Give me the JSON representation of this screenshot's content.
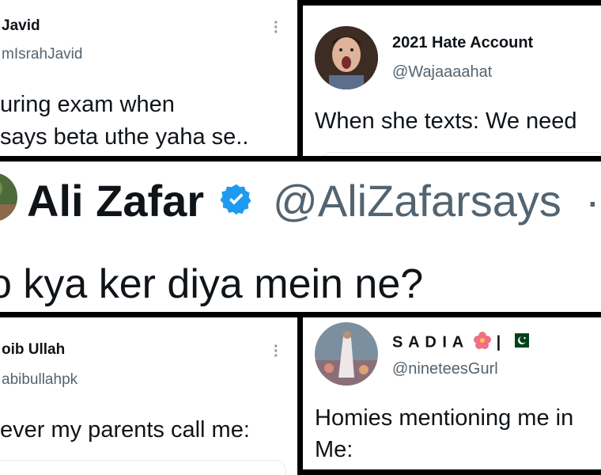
{
  "tweet_top_left": {
    "name": "Javid",
    "handle": "mIsrahJavid",
    "line1": "uring exam when",
    "line2": "says beta uthe yaha se.."
  },
  "tweet_top_right": {
    "name": "2021 Hate Account",
    "handle": "@Wajaaaahat",
    "line1": "When she texts: We need"
  },
  "tweet_middle": {
    "name": "Ali Zafar",
    "handle": "@AliZafarsays",
    "separator": "·",
    "line1": "o kya ker diya mein ne?"
  },
  "tweet_bottom_left": {
    "name": "oib Ullah",
    "handle": "abibullahpk",
    "line1": "ever my parents call me:"
  },
  "tweet_bottom_right": {
    "name": "S A D I A",
    "name_suffix": "|",
    "handle": "@nineteesGurl",
    "line1": "Homies mentioning me in",
    "line2": "Me:"
  },
  "colors": {
    "verified": "#1d9bf0",
    "handle_gray": "#536471",
    "pakistan_green": "#01411c",
    "divider": "#000000"
  },
  "icons": [
    "more-options-icon",
    "verified-badge-icon",
    "hibiscus-emoji-icon",
    "pakistan-flag-icon"
  ]
}
